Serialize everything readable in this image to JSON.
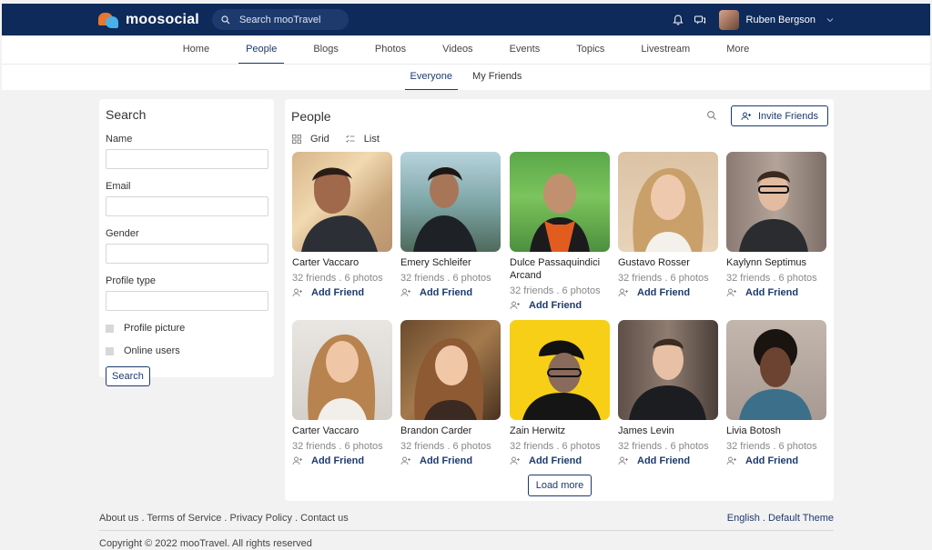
{
  "header": {
    "brand": "moosocial",
    "search_placeholder": "Search mooTravel",
    "user_name": "Ruben Bergson",
    "colors": {
      "bar": "#0e2a5a",
      "accent": "#1d3a6d"
    }
  },
  "nav": {
    "items": [
      "Home",
      "People",
      "Blogs",
      "Photos",
      "Videos",
      "Events",
      "Topics",
      "Livestream",
      "More"
    ],
    "active": "People"
  },
  "subnav": {
    "items": [
      "Everyone",
      "My Friends"
    ],
    "active": "Everyone"
  },
  "search_panel": {
    "title": "Search",
    "name_label": "Name",
    "email_label": "Email",
    "gender_label": "Gender",
    "profile_type_label": "Profile type",
    "profile_picture_label": "Profile picture",
    "online_users_label": "Online users",
    "search_button": "Search"
  },
  "people_panel": {
    "title": "People",
    "invite_label": "Invite Friends",
    "grid_label": "Grid",
    "list_label": "List",
    "add_friend_label": "Add Friend",
    "load_more": "Load more",
    "people": [
      {
        "name": "Carter Vaccaro",
        "meta": "32 friends . 6 photos"
      },
      {
        "name": "Emery Schleifer",
        "meta": "32 friends . 6 photos"
      },
      {
        "name": "Dulce Passaquindici Arcand",
        "meta": "32 friends . 6 photos"
      },
      {
        "name": "Gustavo Rosser",
        "meta": "32 friends . 6 photos"
      },
      {
        "name": "Kaylynn Septimus",
        "meta": "32 friends . 6 photos"
      },
      {
        "name": "Carter Vaccaro",
        "meta": "32 friends . 6 photos"
      },
      {
        "name": "Brandon Carder",
        "meta": "32 friends . 6 photos"
      },
      {
        "name": "Zain Herwitz",
        "meta": "32 friends . 6 photos"
      },
      {
        "name": "James Levin",
        "meta": "32 friends . 6 photos"
      },
      {
        "name": "Livia Botosh",
        "meta": "32 friends . 6 photos"
      }
    ]
  },
  "footer": {
    "links": [
      "About us",
      "Terms of Service",
      "Privacy Policy",
      "Contact us"
    ],
    "language": "English",
    "theme": "Default Theme",
    "copyright": "Copyright © 2022 mooTravel. All rights reserved"
  }
}
